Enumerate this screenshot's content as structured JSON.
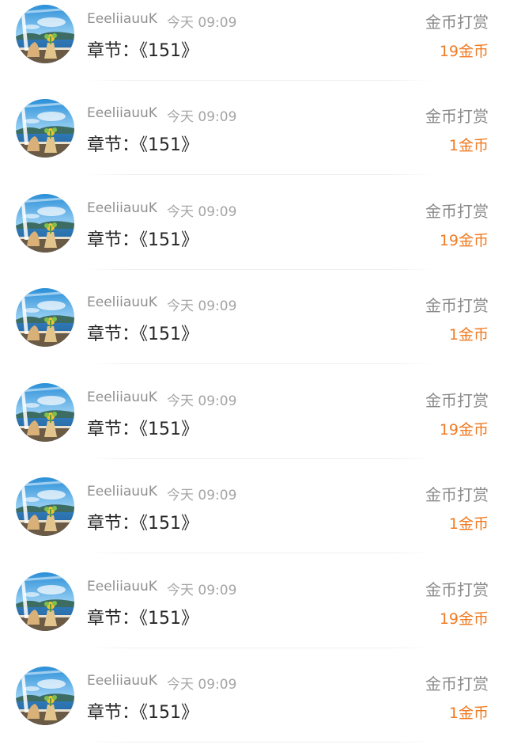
{
  "records": [
    {
      "username": "EeeliiauuK",
      "time": "今天 09:09",
      "chapter": "章节：《151》",
      "type": "金币打赏",
      "amount": "19金币"
    },
    {
      "username": "EeeliiauuK",
      "time": "今天 09:09",
      "chapter": "章节：《151》",
      "type": "金币打赏",
      "amount": "1金币"
    },
    {
      "username": "EeeliiauuK",
      "time": "今天 09:09",
      "chapter": "章节：《151》",
      "type": "金币打赏",
      "amount": "19金币"
    },
    {
      "username": "EeeliiauuK",
      "time": "今天 09:09",
      "chapter": "章节：《151》",
      "type": "金币打赏",
      "amount": "1金币"
    },
    {
      "username": "EeeliiauuK",
      "time": "今天 09:09",
      "chapter": "章节：《151》",
      "type": "金币打赏",
      "amount": "19金币"
    },
    {
      "username": "EeeliiauuK",
      "time": "今天 09:09",
      "chapter": "章节：《151》",
      "type": "金币打赏",
      "amount": "1金币"
    },
    {
      "username": "EeeliiauuK",
      "time": "今天 09:09",
      "chapter": "章节：《151》",
      "type": "金币打赏",
      "amount": "19金币"
    },
    {
      "username": "EeeliiauuK",
      "time": "今天 09:09",
      "chapter": "章节：《151》",
      "type": "金币打赏",
      "amount": "1金币"
    }
  ],
  "colors": {
    "amount": "#f07a22",
    "type_label": "#8a8a8a",
    "username": "#8f8f8f",
    "chapter": "#262626"
  },
  "icons": {
    "avatar": "user-avatar-beach-window-icon"
  }
}
